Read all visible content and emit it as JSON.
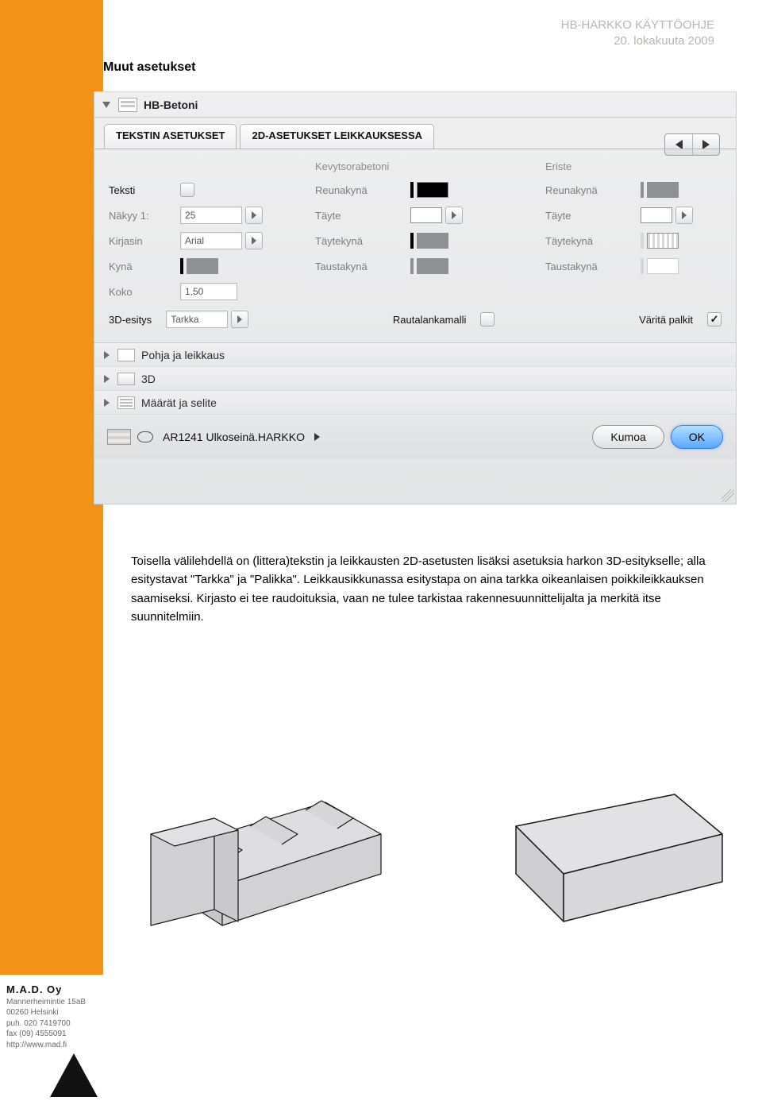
{
  "header": {
    "doc_title": "HB-HARKKO KÄYTTÖOHJE",
    "doc_date": "20. lokakuuta 2009"
  },
  "heading": "Muut asetukset",
  "dialog": {
    "title": "HB-Betoni",
    "tabs": {
      "t1": "TEKSTIN ASETUKSET",
      "t2": "2D-ASETUKSET LEIKKAUKSESSA"
    },
    "left": {
      "teksti": "Teksti",
      "nakyy": "Näkyy 1:",
      "nakyy_val": "25",
      "kirjasin": "Kirjasin",
      "kirjasin_val": "Arial",
      "kyna": "Kynä",
      "koko": "Koko",
      "koko_val": "1,50"
    },
    "mid": {
      "hdr": "Kevytsorabetoni",
      "reunakyna": "Reunakynä",
      "tayte": "Täyte",
      "taytekyna": "Täytekynä",
      "taustakyna": "Taustakynä"
    },
    "right": {
      "hdr": "Eriste",
      "reunakyna": "Reunakynä",
      "tayte": "Täyte",
      "taytekyna": "Täytekynä",
      "taustakyna": "Taustakynä"
    },
    "row3d": {
      "esitys": "3D-esitys",
      "esitys_val": "Tarkka",
      "rautalanka": "Rautalankamalli",
      "varita": "Väritä palkit"
    },
    "groups": {
      "g1": "Pohja ja leikkaus",
      "g2": "3D",
      "g3": "Määrät ja selite"
    },
    "layer": "AR1241 Ulkoseinä.HARKKO",
    "cancel": "Kumoa",
    "ok": "OK"
  },
  "para": "Toisella välilehdellä  on (littera)tekstin ja leikkausten 2D-asetusten lisäksi asetuksia harkon 3D-esitykselle; alla esitystavat \"Tarkka\" ja \"Palikka\". Leikkausikkunassa esitystapa on aina tarkka oikeanlaisen poikkileikkauksen saamiseksi. Kirjasto ei tee raudoituksia, vaan ne tulee tarkistaa rakennesuunnittelijalta ja merkitä itse suunnitelmiin.",
  "footer": {
    "brand": "M.A.D.  Oy",
    "l1": "Mannerheimintie 15aB",
    "l2": "00260  Helsinki",
    "l3": "puh.  020 7419700",
    "l4": "fax   (09) 4555091",
    "l5": "http://www.mad.fi"
  }
}
